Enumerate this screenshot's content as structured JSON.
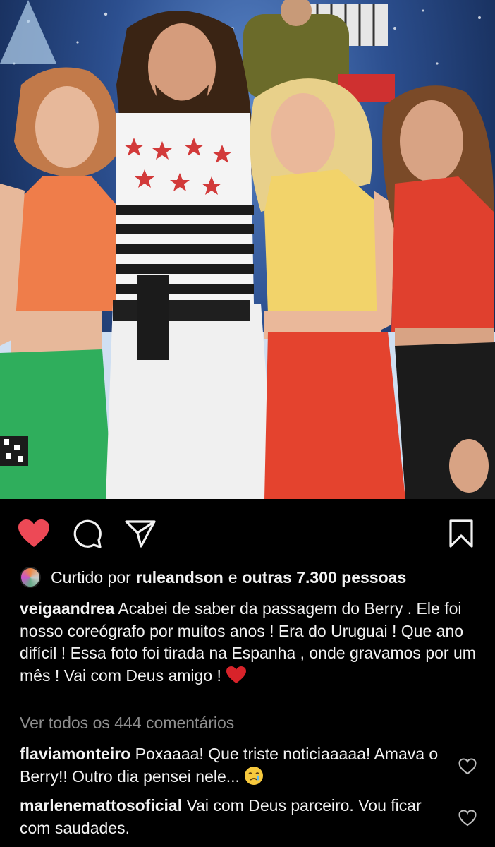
{
  "post": {
    "liked_prefix": "Curtido por",
    "liked_user": "ruleandson",
    "liked_joiner": "e",
    "liked_others": "outras 7.300 pessoas",
    "caption_user": "veigaandrea",
    "caption_text": "Acabei de saber da passagem do Berry . Ele foi nosso coreógrafo por muitos anos ! Era do Uruguai ! Que ano difícil ! Essa foto foi tirada na Espanha , onde gravamos por um mês ! Vai com Deus amigo !",
    "view_all_comments": "Ver todos os 444 comentários"
  },
  "comments": [
    {
      "user": "flaviamonteiro",
      "text": "Poxaaaa! Que triste noticiaaaaa! Amava o Berry!! Outro dia pensei nele..."
    },
    {
      "user": "marlenemattosoficial",
      "text": "Vai com Deus parceiro. Vou ficar com saudades."
    }
  ],
  "icons": {
    "like": "heart-filled-icon",
    "comment": "comment-bubble-icon",
    "share": "paper-plane-icon",
    "save": "bookmark-icon",
    "caption_emoji": "red-heart-emoji",
    "comment_emoji": "crying-face-emoji",
    "comment_like": "heart-outline-icon"
  },
  "colors": {
    "background": "#000000",
    "like_red": "#ed4956",
    "muted_text": "#8e8e8e",
    "text": "#f2f2f2"
  }
}
